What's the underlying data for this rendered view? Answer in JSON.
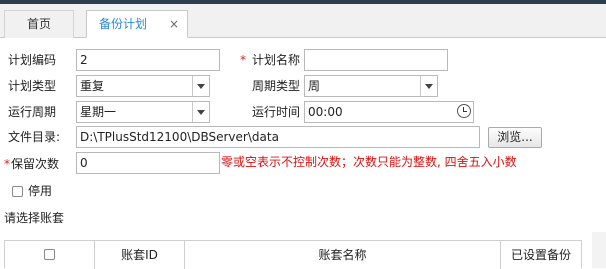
{
  "tabs": {
    "home": "首页",
    "plan": "备份计划",
    "close": "×"
  },
  "form": {
    "plan_code_label": "计划编码",
    "plan_code_value": "2",
    "required_mark": "*",
    "plan_name_label": "计划名称",
    "plan_name_value": "",
    "plan_type_label": "计划类型",
    "plan_type_value": "重复",
    "period_type_label": "周期类型",
    "period_type_value": "周",
    "run_period_label": "运行周期",
    "run_period_value": "星期一",
    "run_time_label": "运行时间",
    "run_time_value": "00:00",
    "file_dir_label": "文件目录:",
    "file_dir_value": "D:\\TPlusStd12100\\DBServer\\data",
    "browse_label": "浏览...",
    "retain_label": "保留次数",
    "retain_value": "0",
    "retain_hint": "零或空表示不控制次数；次数只能为整数, 四舍五入小数",
    "disable_label": "停用",
    "disable_checked": false,
    "choose_account_label": "请选择账套"
  },
  "table": {
    "columns": [
      "账套ID",
      "账套名称",
      "已设置备份"
    ]
  },
  "icons": [
    "close-icon",
    "dropdown-arrow-icon",
    "clock-icon",
    "checkbox-icon"
  ]
}
